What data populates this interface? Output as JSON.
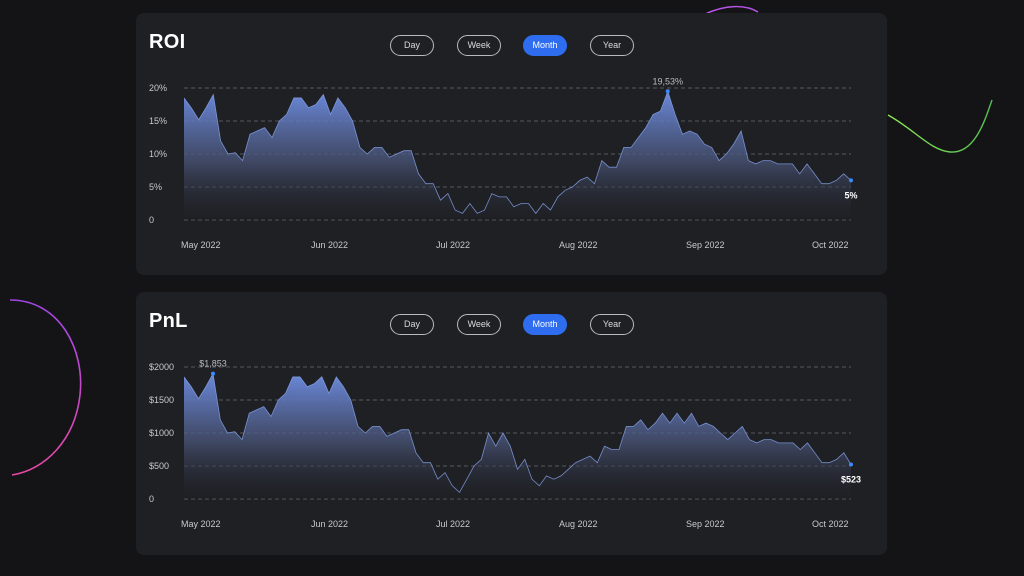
{
  "roi": {
    "title": "ROI",
    "tabs": [
      {
        "label": "Day",
        "active": false
      },
      {
        "label": "Week",
        "active": false
      },
      {
        "label": "Month",
        "active": true
      },
      {
        "label": "Year",
        "active": false
      }
    ],
    "chart_data": {
      "type": "area",
      "x_tick_labels": [
        "May 2022",
        "Jun 2022",
        "Jul 2022",
        "Aug 2022",
        "Sep 2022",
        "Oct 2022"
      ],
      "y_tick_labels": [
        "0",
        "5%",
        "10%",
        "15%",
        "20%"
      ],
      "ylim": [
        0,
        20
      ],
      "grid": "horizontal-dashed",
      "peak_label": "19,53%",
      "end_label": "5%",
      "values": [
        18.5,
        17,
        15.2,
        17,
        19,
        12,
        10,
        10.2,
        9,
        13,
        13.5,
        14,
        12.5,
        15,
        16,
        18.5,
        18.5,
        17,
        17.5,
        19,
        16,
        18.5,
        17,
        15,
        11,
        10,
        11,
        11,
        9.5,
        10,
        10.5,
        10.5,
        7,
        5.5,
        5.5,
        3,
        4,
        1.5,
        1,
        2.5,
        1,
        1.5,
        4,
        3.5,
        3.5,
        2,
        2.5,
        2.5,
        1,
        2.5,
        1.5,
        3.5,
        4.5,
        5,
        6,
        6.5,
        5.5,
        9,
        8,
        8,
        11,
        11,
        12.5,
        14,
        16,
        16.5,
        19.5,
        16,
        13,
        13.5,
        13,
        11.5,
        11,
        9,
        10,
        11.5,
        13.5,
        9,
        8.5,
        9,
        9,
        8.5,
        8.5,
        8.5,
        7,
        8.5,
        7,
        5.5,
        5.5,
        6,
        7,
        6
      ]
    },
    "tooltip_color": "#3a8bff",
    "accent": "#2f6df0"
  },
  "pnl": {
    "title": "PnL",
    "tabs": [
      {
        "label": "Day",
        "active": false
      },
      {
        "label": "Week",
        "active": false
      },
      {
        "label": "Month",
        "active": true
      },
      {
        "label": "Year",
        "active": false
      }
    ],
    "chart_data": {
      "type": "area",
      "x_tick_labels": [
        "May 2022",
        "Jun 2022",
        "Jul 2022",
        "Aug 2022",
        "Sep 2022",
        "Oct 2022"
      ],
      "y_tick_labels": [
        "0",
        "$500",
        "$1000",
        "$1500",
        "$2000"
      ],
      "ylim": [
        0,
        2000
      ],
      "grid": "horizontal-dashed",
      "peak_label": "$1,853",
      "end_label": "$523",
      "values": [
        1850,
        1700,
        1520,
        1700,
        1900,
        1200,
        1000,
        1020,
        900,
        1300,
        1350,
        1400,
        1250,
        1500,
        1600,
        1850,
        1850,
        1700,
        1750,
        1853,
        1600,
        1850,
        1700,
        1500,
        1100,
        1000,
        1100,
        1100,
        950,
        1000,
        1050,
        1050,
        700,
        550,
        550,
        300,
        400,
        200,
        100,
        300,
        500,
        600,
        1000,
        800,
        1000,
        800,
        450,
        600,
        300,
        200,
        350,
        300,
        350,
        450,
        550,
        600,
        650,
        550,
        800,
        750,
        750,
        1100,
        1100,
        1200,
        1050,
        1150,
        1300,
        1150,
        1300,
        1150,
        1300,
        1100,
        1150,
        1100,
        1000,
        900,
        1000,
        1100,
        900,
        850,
        900,
        900,
        850,
        850,
        850,
        750,
        850,
        700,
        550,
        550,
        600,
        700,
        523
      ]
    },
    "tooltip_color": "#3a8bff",
    "accent": "#2f6df0"
  }
}
